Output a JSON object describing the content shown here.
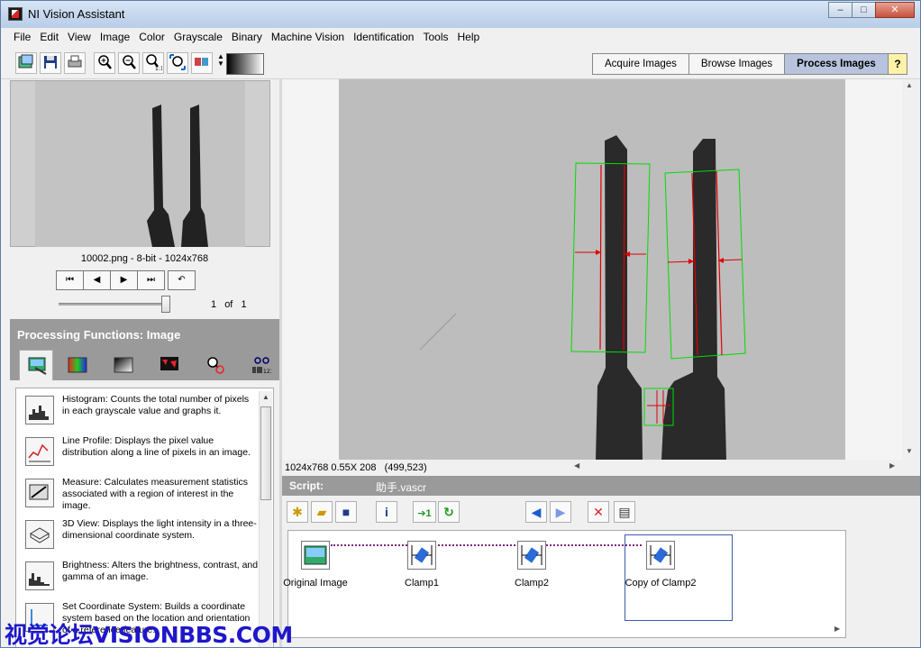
{
  "window": {
    "title": "NI Vision Assistant",
    "minimize": "–",
    "maximize": "□",
    "close": "✕"
  },
  "menu": [
    "File",
    "Edit",
    "View",
    "Image",
    "Color",
    "Grayscale",
    "Binary",
    "Machine Vision",
    "Identification",
    "Tools",
    "Help"
  ],
  "mode_tabs": [
    {
      "label": "Acquire Images",
      "active": false
    },
    {
      "label": "Browse Images",
      "active": false
    },
    {
      "label": "Process Images",
      "active": true
    }
  ],
  "help_label": "?",
  "thumbnail": {
    "caption": "10002.png - 8-bit - 1024x768"
  },
  "browser": {
    "current_page": "1",
    "of_label": "of",
    "total_pages": "1"
  },
  "processing": {
    "header": "Processing Functions: Image",
    "items": [
      {
        "icon": "histogram-icon",
        "text": "Histogram:  Counts the total number of pixels in each grayscale value and graphs it."
      },
      {
        "icon": "line-profile-icon",
        "text": "Line Profile:  Displays the pixel value distribution along a line of pixels in an image."
      },
      {
        "icon": "measure-icon",
        "text": "Measure:  Calculates measurement statistics associated with a region of interest in the image."
      },
      {
        "icon": "3d-view-icon",
        "text": "3D View:  Displays the light intensity in a three-dimensional coordinate system."
      },
      {
        "icon": "brightness-icon",
        "text": "Brightness:  Alters the brightness, contrast, and gamma of an image."
      },
      {
        "icon": "coordinate-system-icon",
        "text": "Set Coordinate System:  Builds a coordinate system based on the location and orientation of a reference feature."
      }
    ]
  },
  "image_status": {
    "size_zoom": "1024x768 0.55X 208",
    "coords": "(499,523)"
  },
  "script": {
    "label": "Script:",
    "name": "助手.vascr",
    "steps": [
      {
        "label": "Original Image",
        "icon": "original-image-icon",
        "selected": false
      },
      {
        "label": "Clamp1",
        "icon": "clamp-icon",
        "selected": false
      },
      {
        "label": "Clamp2",
        "icon": "clamp-icon",
        "selected": false
      },
      {
        "label": "Copy of Clamp2",
        "icon": "clamp-icon",
        "selected": true
      }
    ]
  },
  "watermark": "视觉论坛VISIONBBS.COM",
  "colors": {
    "roi_green": "#00dd00",
    "edge_red": "#e00000",
    "panel_gray": "#9a9a9a",
    "active_tab": "#b8c4dd",
    "watermark_blue": "#1f17c9"
  }
}
